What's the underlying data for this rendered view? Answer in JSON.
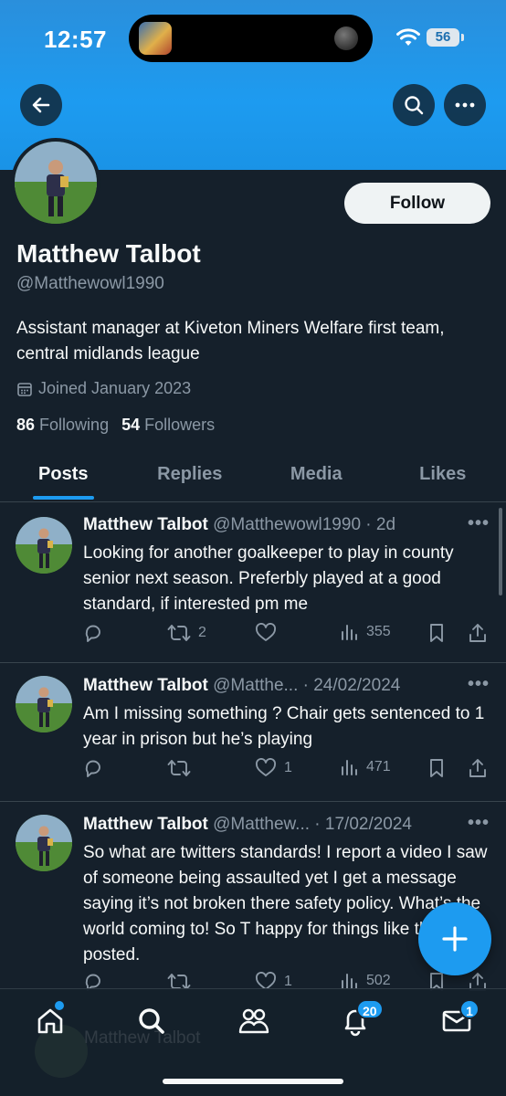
{
  "status_bar": {
    "time": "12:57",
    "battery": "56"
  },
  "profile": {
    "display_name": "Matthew Talbot",
    "handle": "@Matthewowl1990",
    "bio": "Assistant manager at Kiveton Miners Welfare first team, central midlands league",
    "joined": "Joined January 2023",
    "following_count": "86",
    "following_label": "Following",
    "followers_count": "54",
    "followers_label": "Followers",
    "follow_label": "Follow"
  },
  "tabs": [
    {
      "label": "Posts",
      "active": true
    },
    {
      "label": "Replies",
      "active": false
    },
    {
      "label": "Media",
      "active": false
    },
    {
      "label": "Likes",
      "active": false
    }
  ],
  "posts": [
    {
      "name": "Matthew Talbot",
      "meta": "@Matthewowl1990 · 2d",
      "text": "Looking for another goalkeeper to play in county senior next season. Preferbly played at a good standard, if interested pm me",
      "reposts": "2",
      "likes": "",
      "views": "355"
    },
    {
      "name": "Matthew Talbot",
      "meta": "@Matthe... · 24/02/2024",
      "text": "Am I missing something ? Chair gets sentenced to 1 year in prison but he’s playing",
      "reposts": "",
      "likes": "1",
      "views": "471"
    },
    {
      "name": "Matthew Talbot",
      "meta": "@Matthew... · 17/02/2024",
      "text": "So what are twitters standards! I report a video I saw of someone being assaulted yet I get a message saying it’s not broken there safety policy. What’s the world coming to! So T happy for things like that to be posted.",
      "reposts": "",
      "likes": "1",
      "views": "502"
    }
  ],
  "ghost_post": {
    "name": "Matthew Talbot"
  },
  "nav": {
    "notifications_badge": "20",
    "messages_badge": "1"
  },
  "colors": {
    "accent": "#1d9bf0",
    "background": "#15202b",
    "muted": "#8b98a5"
  }
}
